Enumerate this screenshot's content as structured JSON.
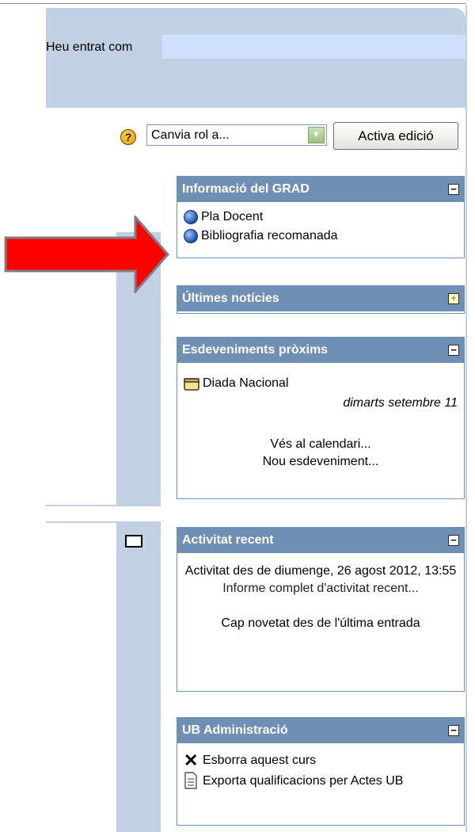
{
  "header": {
    "login_prefix": "Heu entrat com",
    "login_value": ""
  },
  "toolbar": {
    "help_icon": "help-icon",
    "role_select_value": "Canvia rol a...",
    "edit_button_label": "Activa edició"
  },
  "blocks": {
    "grad_info": {
      "title": "Informació del GRAD",
      "toggle": "−",
      "links": [
        "Pla Docent",
        "Bibliografia recomanada"
      ]
    },
    "latest_news": {
      "title": "Últimes notícies",
      "toggle": "+"
    },
    "upcoming_events": {
      "title": "Esdeveniments pròxims",
      "toggle": "−",
      "event_name": "Diada Nacional",
      "event_date": "dimarts setembre 11",
      "go_calendar": "Vés al calendari...",
      "new_event": "Nou esdeveniment..."
    },
    "recent_activity": {
      "title": "Activitat recent",
      "toggle": "−",
      "since": "Activitat des de diumenge, 26 agost 2012, 13:55",
      "full_report": "Informe complet d'activitat recent...",
      "no_news": "Cap novetat des de l'última entrada"
    },
    "ub_admin": {
      "title": "UB Administració",
      "toggle": "−",
      "items": [
        "Esborra aquest curs",
        "Exporta qualificacions per Actes UB"
      ]
    }
  },
  "colors": {
    "header_bg": "#c1d1e3",
    "block_header": "#6f8fb5",
    "arrow": "#ff0000"
  }
}
